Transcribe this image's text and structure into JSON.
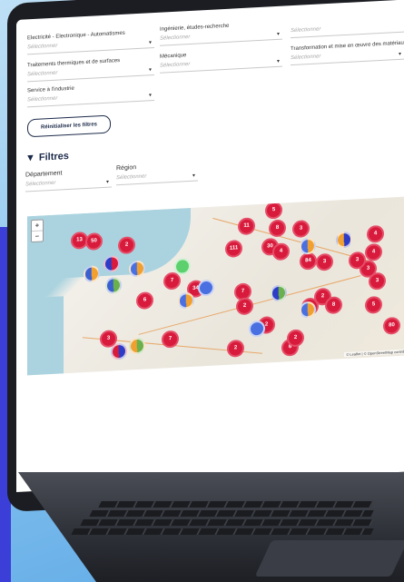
{
  "filters_top": [
    {
      "label": "Electricité - Electronique - Automatismes",
      "placeholder": "Sélectionner"
    },
    {
      "label": "Ingénierie, études-recherche",
      "placeholder": "Sélectionner"
    },
    {
      "label": "",
      "placeholder": "Sélectionner"
    },
    {
      "label": "Traitements thermiques et de surfaces",
      "placeholder": "Sélectionner"
    },
    {
      "label": "Mécanique",
      "placeholder": "Sélectionner"
    },
    {
      "label": "Transformation et mise en œuvre des matériaux",
      "placeholder": "Sélectionner"
    },
    {
      "label": "Service à l'industrie",
      "placeholder": "Sélectionner"
    }
  ],
  "reset_button": "Réinitialiser les filtres",
  "filtres_section": {
    "title": "Filtres",
    "departement": {
      "label": "Département",
      "placeholder": "Sélectionner"
    },
    "region": {
      "label": "Région",
      "placeholder": "Sélectionner"
    }
  },
  "map": {
    "zoom_in": "+",
    "zoom_out": "−",
    "attribution": "© Leaflet | © OpenStreetMap contributors",
    "clusters": [
      "13",
      "50",
      "2",
      "7",
      "5",
      "11",
      "8",
      "3",
      "30",
      "111",
      "4",
      "84",
      "3",
      "4",
      "3",
      "4",
      "6",
      "34",
      "7",
      "2",
      "2",
      "9",
      "8",
      "5",
      "80",
      "3",
      "3",
      "7",
      "2",
      "2",
      "6",
      "4",
      "2",
      "3"
    ]
  },
  "colors": {
    "marker": "#d81b3c",
    "accent": "#1c2a4a"
  }
}
